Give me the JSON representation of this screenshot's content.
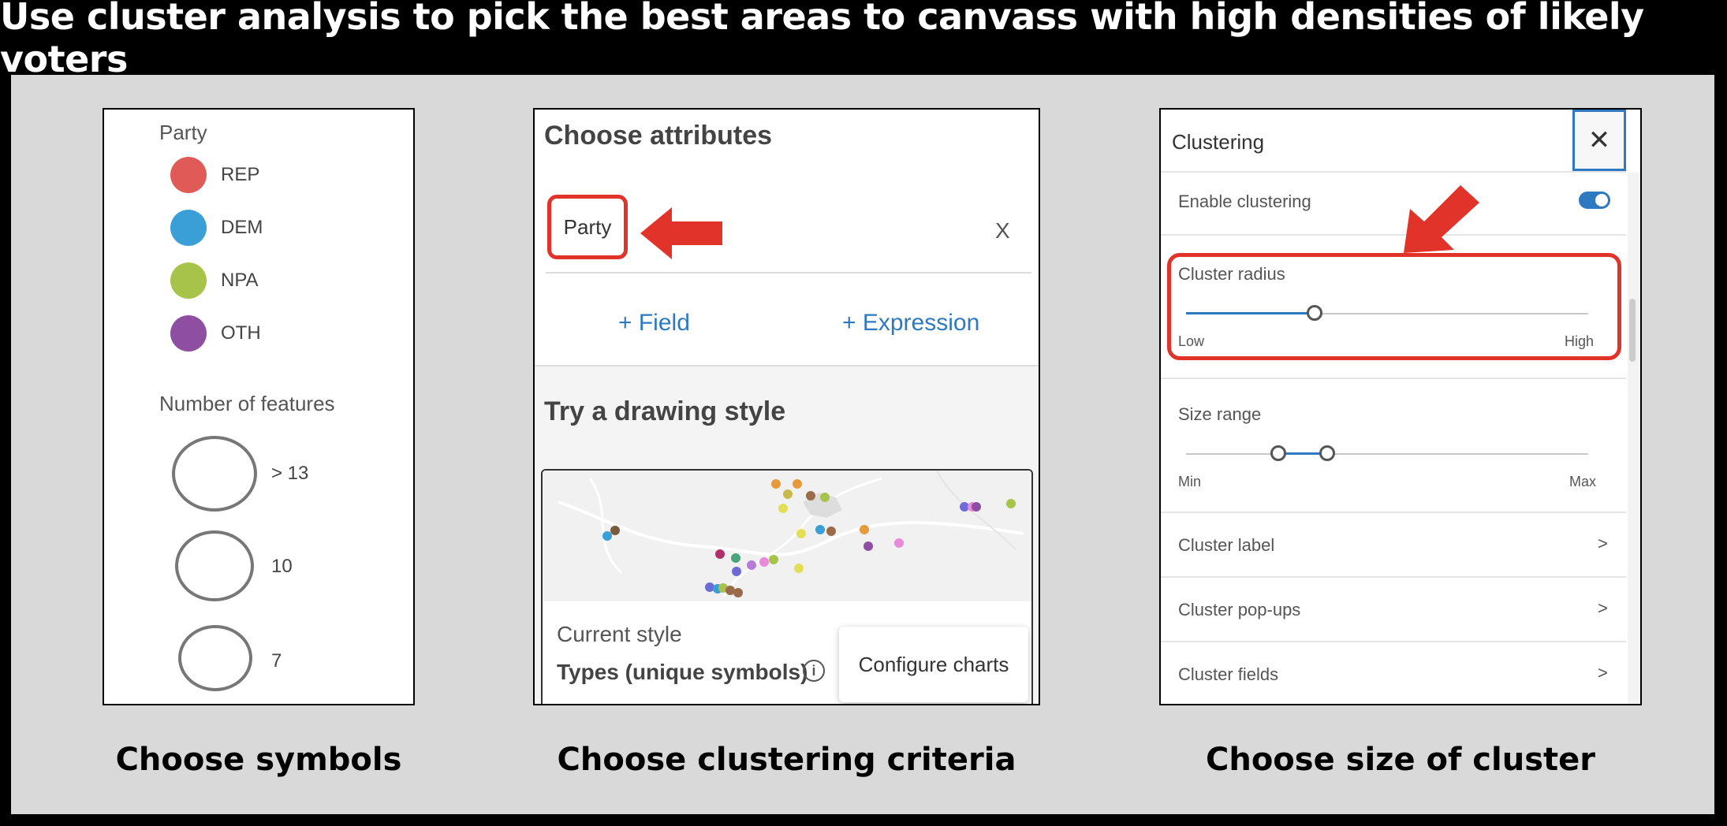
{
  "title": "Use cluster analysis to pick the best areas to canvass with high densities of likely voters",
  "colors": {
    "rep": "#e05a57",
    "dem": "#3a9fd6",
    "npa": "#a8c34a",
    "oth": "#8e4fa3",
    "accent_blue": "#2f79c0",
    "highlight_red": "#e2332b"
  },
  "legend": {
    "party_heading": "Party",
    "items": [
      {
        "label": "REP",
        "color": "#e05a57"
      },
      {
        "label": "DEM",
        "color": "#3a9fd6"
      },
      {
        "label": "NPA",
        "color": "#a8c34a"
      },
      {
        "label": "OTH",
        "color": "#8e4fa3"
      }
    ],
    "size_heading": "Number of features",
    "sizes": [
      {
        "label": "> 13"
      },
      {
        "label": "10"
      },
      {
        "label": "7"
      }
    ]
  },
  "attributes": {
    "heading": "Choose attributes",
    "selected_field": "Party",
    "remove_label": "X",
    "add_field": "+   Field",
    "add_expression": "+   Expression",
    "drawing_heading": "Try a drawing style",
    "current_style_label": "Current style",
    "current_style_value": "Types (unique symbols)",
    "info_icon_glyph": "i",
    "configure_charts": "Configure charts"
  },
  "clustering": {
    "title": "Clustering",
    "close_glyph": "✕",
    "enable_label": "Enable clustering",
    "enable_on": true,
    "radius_label": "Cluster radius",
    "radius_low": "Low",
    "radius_high": "High",
    "radius_value": 0.32,
    "size_label": "Size range",
    "size_min": "Min",
    "size_max": "Max",
    "size_range": [
      0.23,
      0.35
    ],
    "rows": [
      {
        "label": "Cluster label",
        "chevron": ">"
      },
      {
        "label": "Cluster pop-ups",
        "chevron": ">"
      },
      {
        "label": "Cluster fields",
        "chevron": ">"
      }
    ]
  },
  "captions": {
    "symbols": "Choose symbols",
    "criteria": "Choose clustering criteria",
    "size": "Choose size of cluster"
  }
}
